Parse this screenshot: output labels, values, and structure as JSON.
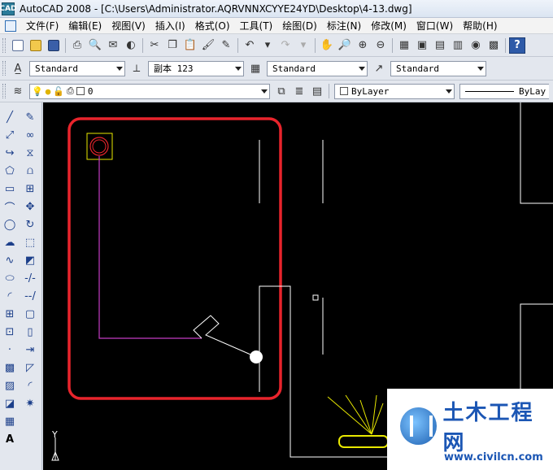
{
  "window": {
    "title": "AutoCAD 2008 - [C:\\Users\\Administrator.AQRVNNXCYYE24YD\\Desktop\\4-13.dwg]",
    "app_icon_text": "CAD"
  },
  "menu": [
    {
      "label": "文件(F)"
    },
    {
      "label": "编辑(E)"
    },
    {
      "label": "视图(V)"
    },
    {
      "label": "插入(I)"
    },
    {
      "label": "格式(O)"
    },
    {
      "label": "工具(T)"
    },
    {
      "label": "绘图(D)"
    },
    {
      "label": "标注(N)"
    },
    {
      "label": "修改(M)"
    },
    {
      "label": "窗口(W)"
    },
    {
      "label": "帮助(H)"
    }
  ],
  "styles_toolbar": {
    "text_style": "Standard",
    "dim_style": "副本 123",
    "table_style": "Standard",
    "multileader_style": "Standard"
  },
  "layers_toolbar": {
    "current_layer": "0",
    "color": "ByLayer",
    "linetype": "ByLay"
  },
  "canvas": {
    "ucs_label": "Y",
    "background": "#000000",
    "highlight_color": "#e8242c"
  },
  "watermark": {
    "title": "土木工程网",
    "url": "www.civilcn.com"
  }
}
